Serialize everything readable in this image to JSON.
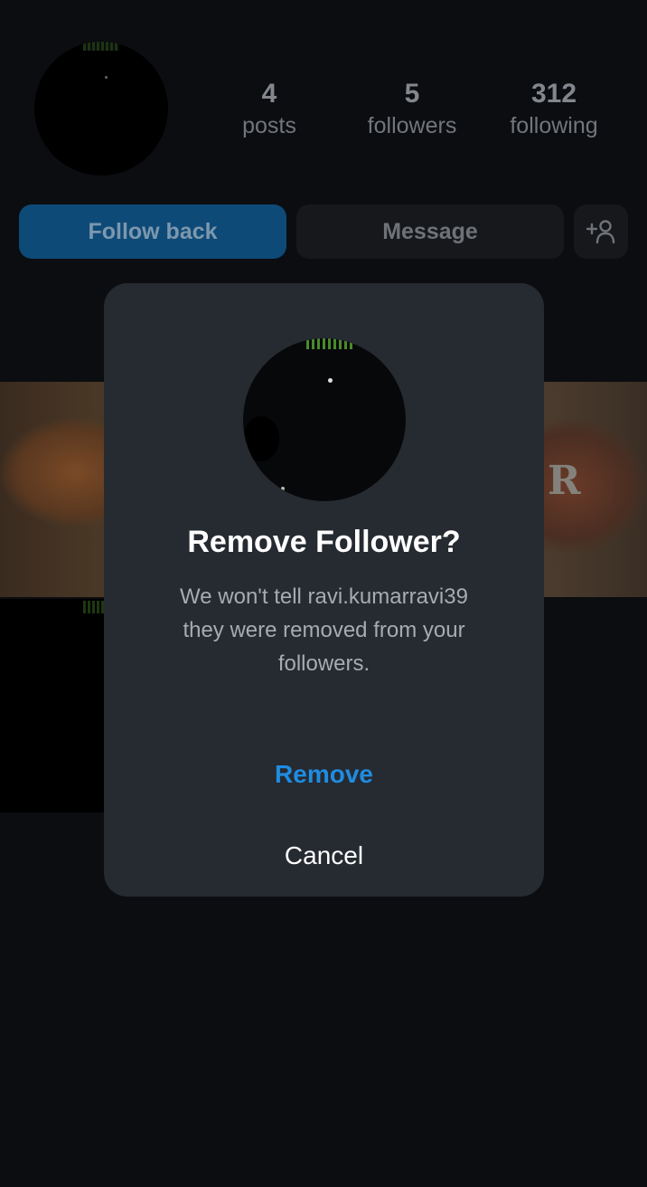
{
  "profile": {
    "stats": [
      {
        "value": "4",
        "label": "posts"
      },
      {
        "value": "5",
        "label": "followers"
      },
      {
        "value": "312",
        "label": "following"
      }
    ],
    "actions": {
      "follow_back": "Follow back",
      "message": "Message"
    },
    "highlight_watermark": "R"
  },
  "dialog": {
    "title": "Remove Follower?",
    "body_lines": [
      "We won't tell ravi.kumarravi39",
      "they were removed from your",
      "followers."
    ],
    "remove_label": "Remove",
    "cancel_label": "Cancel"
  },
  "colors": {
    "accent": "#1f8ce0",
    "dialog_bg": "#262a31",
    "page_bg": "#0b0d10"
  }
}
